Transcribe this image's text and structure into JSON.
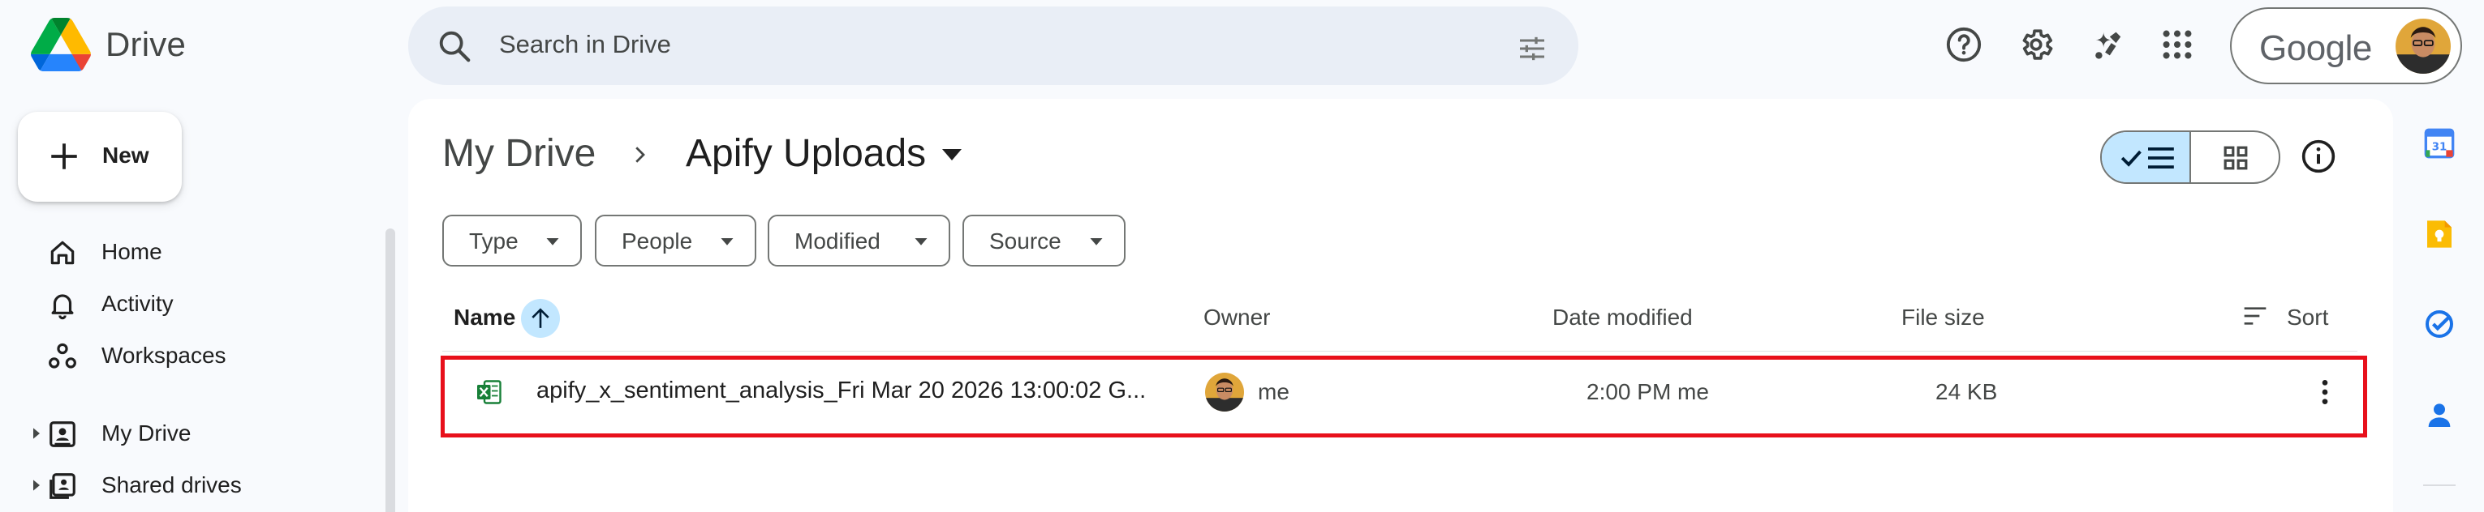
{
  "app": {
    "name": "Drive",
    "account_label": "Google"
  },
  "search": {
    "placeholder": "Search in Drive"
  },
  "sidebar": {
    "new_label": "New",
    "items": [
      {
        "label": "Home",
        "icon": "home-icon"
      },
      {
        "label": "Activity",
        "icon": "bell-icon"
      },
      {
        "label": "Workspaces",
        "icon": "workspaces-icon"
      },
      {
        "label": "My Drive",
        "icon": "my-drive-icon"
      },
      {
        "label": "Shared drives",
        "icon": "shared-drives-icon"
      }
    ]
  },
  "breadcrumb": {
    "root": "My Drive",
    "current": "Apify Uploads"
  },
  "filters": [
    "Type",
    "People",
    "Modified",
    "Source"
  ],
  "columns": {
    "name": "Name",
    "owner": "Owner",
    "modified": "Date modified",
    "size": "File size",
    "sort": "Sort"
  },
  "files": [
    {
      "name": "apify_x_sentiment_analysis_Fri Mar 20 2026 13:00:02 G...",
      "type": "excel-spreadsheet",
      "owner": "me",
      "modified": "2:00 PM me",
      "size": "24 KB"
    }
  ],
  "colors": {
    "background": "#f8fafd",
    "search_bg": "#e9eef6",
    "selected_toggle": "#c2e7ff",
    "highlight_border": "#e8101b",
    "excel_green": "#188038"
  },
  "side_apps": [
    "calendar-icon",
    "keep-icon",
    "tasks-icon",
    "contacts-icon"
  ]
}
